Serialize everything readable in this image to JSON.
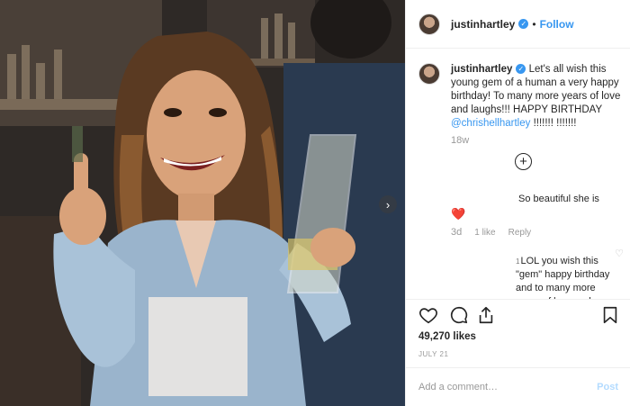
{
  "header": {
    "username": "justinhartley",
    "separator": "•",
    "follow_label": "Follow"
  },
  "caption": {
    "username": "justinhartley",
    "text_before": " Let's all wish this young gem of a human a very happy birthday! To many more years of love and laughs!!! HAPPY BIRTHDAY ",
    "mention": "@chrishellhartley",
    "text_after": " !!!!!!! !!!!!!!",
    "time": "18w"
  },
  "load_more_icon": "plus-circle-icon",
  "comments": [
    {
      "text": "So beautiful she is",
      "emoji": "❤️",
      "time": "3d",
      "likes": "1 like",
      "reply": "Reply"
    },
    {
      "badge": "1",
      "text": "LOL you wish this \"gem\" happy birthday and to many more years of love and laughs"
    }
  ],
  "actions": {
    "like_icon": "heart-icon",
    "comment_icon": "comment-icon",
    "share_icon": "share-icon",
    "save_icon": "bookmark-icon"
  },
  "likes_count": "49,270 likes",
  "date": "JULY 21",
  "add_comment": {
    "placeholder": "Add a comment…",
    "post_label": "Post"
  },
  "carousel": {
    "next_icon": "chevron-right-icon",
    "next_glyph": "›"
  },
  "colors": {
    "link": "#3897f0",
    "heart": "#ed4956",
    "muted": "#999999"
  }
}
